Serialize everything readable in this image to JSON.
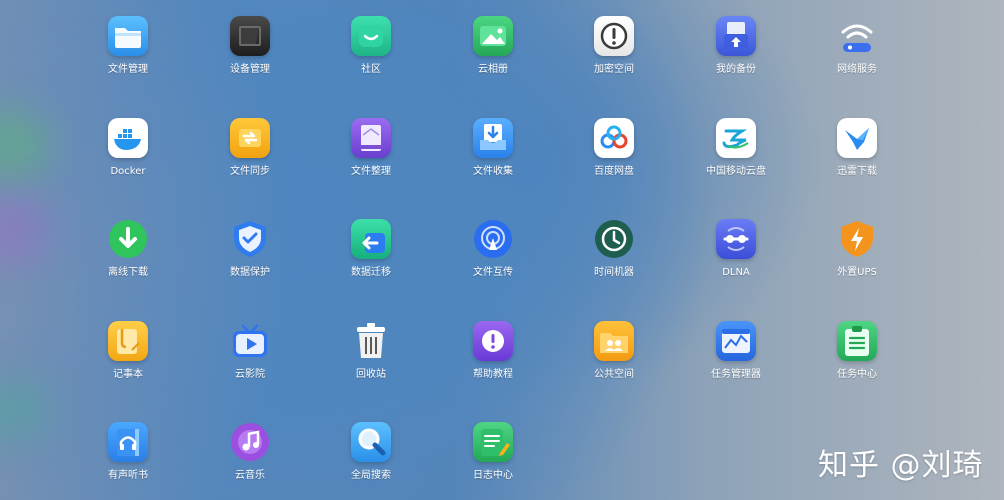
{
  "apps": [
    {
      "id": "file-manager",
      "label": "文件管理",
      "icon": "folder-icon",
      "color": "#3aa0f0"
    },
    {
      "id": "device-manager",
      "label": "设备管理",
      "icon": "device-icon",
      "color": "#3a3a3a"
    },
    {
      "id": "community",
      "label": "社区",
      "icon": "chat-smile-icon",
      "color": "#28c39a"
    },
    {
      "id": "cloud-album",
      "label": "云相册",
      "icon": "photo-icon",
      "color": "#35c06a"
    },
    {
      "id": "encrypted-space",
      "label": "加密空间",
      "icon": "lock-icon",
      "color": "#f2f2f2"
    },
    {
      "id": "my-backup",
      "label": "我的备份",
      "icon": "backup-icon",
      "color": "#4a6de8"
    },
    {
      "id": "network-service",
      "label": "网络服务",
      "icon": "wifi-icon",
      "color": "#ffffff"
    },
    {
      "id": "docker",
      "label": "Docker",
      "icon": "docker-whale-icon",
      "color": "#ffffff"
    },
    {
      "id": "file-sync",
      "label": "文件同步",
      "icon": "sync-icon",
      "color": "#f6b21c"
    },
    {
      "id": "file-organize",
      "label": "文件整理",
      "icon": "organize-icon",
      "color": "#7a4fd6"
    },
    {
      "id": "file-collect",
      "label": "文件收集",
      "icon": "inbox-download-icon",
      "color": "#2f8ff2"
    },
    {
      "id": "baidu-netdisk",
      "label": "百度网盘",
      "icon": "baidu-cloud-icon",
      "color": "#ffffff"
    },
    {
      "id": "china-mobile-cloud",
      "label": "中国移动云盘",
      "icon": "mobile-cloud-icon",
      "color": "#ffffff"
    },
    {
      "id": "xunlei-download",
      "label": "迅雷下载",
      "icon": "bird-icon",
      "color": "#ffffff"
    },
    {
      "id": "offline-download",
      "label": "离线下载",
      "icon": "download-arrow-icon",
      "color": "#2fc45c"
    },
    {
      "id": "data-protection",
      "label": "数据保护",
      "icon": "shield-check-icon",
      "color": "#2e7cf0"
    },
    {
      "id": "data-migration",
      "label": "数据迁移",
      "icon": "migrate-icon",
      "color": "#1fbf8a"
    },
    {
      "id": "file-transfer",
      "label": "文件互传",
      "icon": "airdrop-icon",
      "color": "#2a6df0"
    },
    {
      "id": "time-machine",
      "label": "时间机器",
      "icon": "clock-history-icon",
      "color": "#1d6e5a"
    },
    {
      "id": "dlna",
      "label": "DLNA",
      "icon": "dlna-icon",
      "color": "#4b5ee8"
    },
    {
      "id": "external-ups",
      "label": "外置UPS",
      "icon": "power-shield-icon",
      "color": "#f5941d"
    },
    {
      "id": "notepad",
      "label": "记事本",
      "icon": "note-icon",
      "color": "#f7b320"
    },
    {
      "id": "cloud-cinema",
      "label": "云影院",
      "icon": "tv-play-icon",
      "color": "#2f73f0"
    },
    {
      "id": "recycle-bin",
      "label": "回收站",
      "icon": "trash-icon",
      "color": "#ffffff"
    },
    {
      "id": "help-tutorial",
      "label": "帮助教程",
      "icon": "help-icon",
      "color": "#7a48e0"
    },
    {
      "id": "public-space",
      "label": "公共空间",
      "icon": "shared-folder-icon",
      "color": "#f6a51c"
    },
    {
      "id": "task-manager",
      "label": "任务管理器",
      "icon": "monitor-chart-icon",
      "color": "#2e7cf0"
    },
    {
      "id": "task-center",
      "label": "任务中心",
      "icon": "clipboard-list-icon",
      "color": "#34c46b"
    },
    {
      "id": "audiobook",
      "label": "有声听书",
      "icon": "headphone-book-icon",
      "color": "#2f8ff2"
    },
    {
      "id": "cloud-music",
      "label": "云音乐",
      "icon": "music-icon",
      "color": "#9b4fe0"
    },
    {
      "id": "global-search",
      "label": "全局搜索",
      "icon": "magnifier-icon",
      "color": "#3aa0f0"
    },
    {
      "id": "log-center",
      "label": "日志中心",
      "icon": "log-pencil-icon",
      "color": "#2fbf6a"
    }
  ],
  "watermark": "知乎 @刘琦"
}
